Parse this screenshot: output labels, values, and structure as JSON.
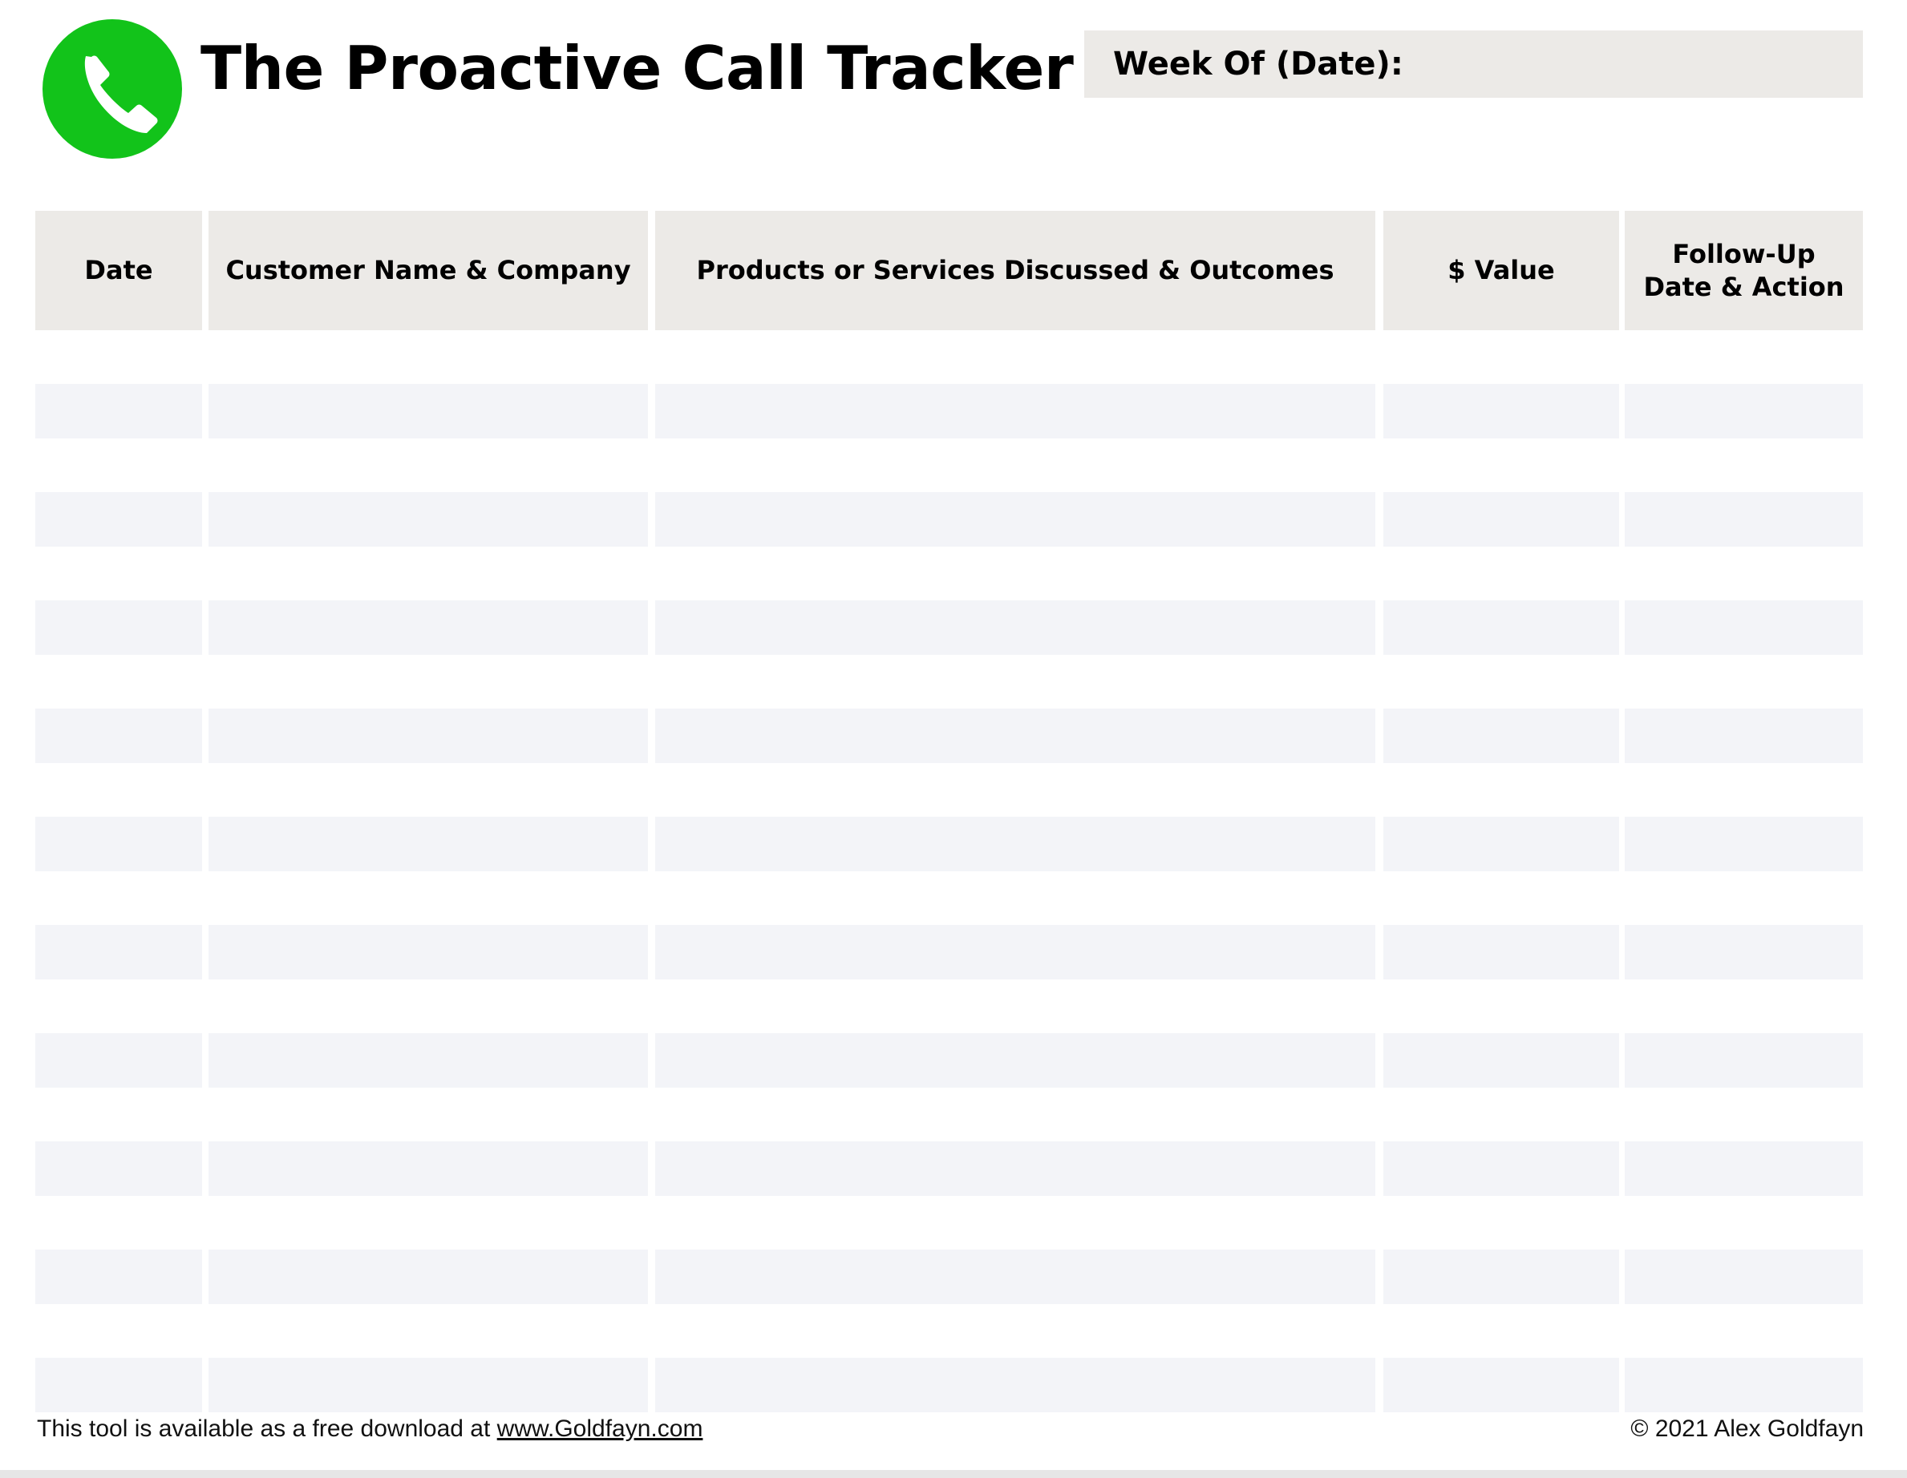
{
  "header": {
    "title": "The Proactive Call Tracker",
    "week_label": "Week Of (Date):",
    "logo_icon": "phone-icon",
    "logo_color": "#12c31a"
  },
  "table": {
    "columns": [
      "Date",
      "Customer Name & Company",
      "Products or Services Discussed & Outcomes",
      "$ Value",
      "Follow-Up\nDate & Action"
    ],
    "header_bg": "#eceae7",
    "row_bg": "#f3f4f8"
  },
  "footer": {
    "prefix": "This tool is available as a free download at ",
    "link": "www.Goldfayn.com",
    "copyright": "© 2021 Alex Goldfayn"
  }
}
